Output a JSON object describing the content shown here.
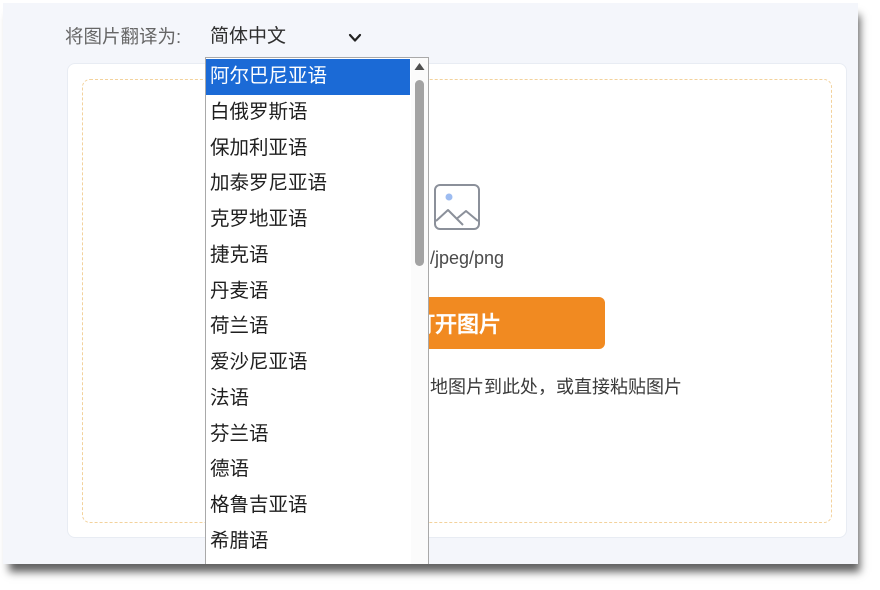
{
  "header": {
    "label": "将图片翻译为:",
    "select_value": "简体中文"
  },
  "upload": {
    "formats_text": "/jpeg/png",
    "button_label": "打开图片",
    "hint_text": "地图片到此处，或直接粘贴图片"
  },
  "dropdown": {
    "options": [
      {
        "label": "阿尔巴尼亚语",
        "highlighted": true
      },
      {
        "label": "白俄罗斯语",
        "highlighted": false
      },
      {
        "label": "保加利亚语",
        "highlighted": false
      },
      {
        "label": "加泰罗尼亚语",
        "highlighted": false
      },
      {
        "label": "克罗地亚语",
        "highlighted": false
      },
      {
        "label": "捷克语",
        "highlighted": false
      },
      {
        "label": "丹麦语",
        "highlighted": false
      },
      {
        "label": "荷兰语",
        "highlighted": false
      },
      {
        "label": "爱沙尼亚语",
        "highlighted": false
      },
      {
        "label": "法语",
        "highlighted": false
      },
      {
        "label": "芬兰语",
        "highlighted": false
      },
      {
        "label": "德语",
        "highlighted": false
      },
      {
        "label": "格鲁吉亚语",
        "highlighted": false
      },
      {
        "label": "希腊语",
        "highlighted": false
      }
    ]
  },
  "colors": {
    "button_orange": "#f18a21",
    "option_highlight": "#1b6ad6",
    "dashed_border": "#f3d29c"
  },
  "icons": {
    "select_arrow": "chevron-down-icon",
    "upload_placeholder": "image-icon",
    "scroll_up": "triangle-up-icon"
  }
}
